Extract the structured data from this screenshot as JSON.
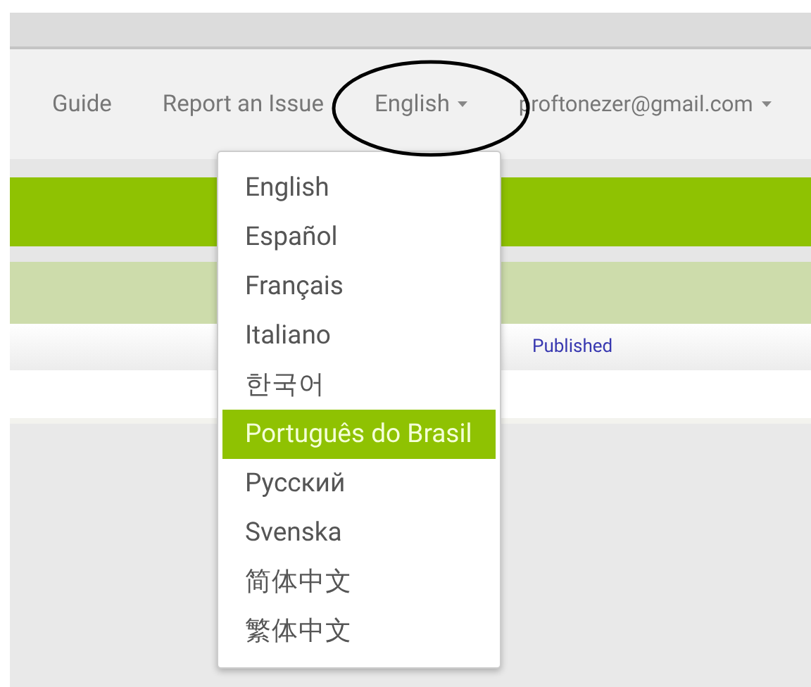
{
  "nav": [
    {
      "label": "Guide",
      "kind": "link"
    },
    {
      "label": "Report an Issue",
      "kind": "link"
    },
    {
      "label": "English",
      "kind": "dropdown"
    },
    {
      "label": "proftonezer@gmail.com",
      "kind": "dropdown"
    }
  ],
  "language_menu": {
    "items": [
      {
        "label": "English",
        "selected": false
      },
      {
        "label": "Español",
        "selected": false
      },
      {
        "label": "Français",
        "selected": false
      },
      {
        "label": "Italiano",
        "selected": false
      },
      {
        "label": "한국어",
        "selected": false
      },
      {
        "label": "Português do Brasil",
        "selected": true
      },
      {
        "label": "Русский",
        "selected": false
      },
      {
        "label": "Svenska",
        "selected": false
      },
      {
        "label": "简体中文",
        "selected": false
      },
      {
        "label": "繁体中文",
        "selected": false
      }
    ]
  },
  "table": {
    "header": "Published"
  }
}
